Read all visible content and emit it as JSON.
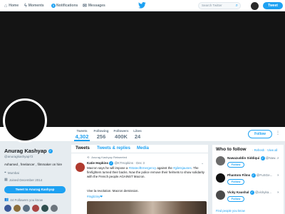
{
  "nav": {
    "home": "Home",
    "moments": "Moments",
    "notifications": "Notifications",
    "notifications_count": "1",
    "messages": "Messages",
    "search_placeholder": "Search Twitter",
    "tweet_button": "Tweet",
    "icons": {
      "home": "home-icon",
      "moments": "bolt-icon",
      "notifications": "bell-icon",
      "messages": "mail-icon",
      "logo": "twitter-bird-icon",
      "search": "search-icon"
    }
  },
  "profile_nav": {
    "stats": [
      {
        "label": "Tweets",
        "value": "4,302",
        "active": true
      },
      {
        "label": "Following",
        "value": "256",
        "active": false
      },
      {
        "label": "Followers",
        "value": "400K",
        "active": false
      },
      {
        "label": "Likes",
        "value": "24",
        "active": false
      }
    ],
    "follow_button": "Follow"
  },
  "profile": {
    "name": "Anurag Kashyap",
    "handle": "@anuragkashyap72",
    "bio": "Ashamed , freelancer , filmmaker on hire",
    "location": "Mumbai",
    "joined": "Joined December 2014",
    "tweet_to_button": "Tweet to Anurag Kashyap",
    "followers_you_know": "44 Followers you know",
    "mini_avatar_colors": [
      "#3b5998",
      "#8a6d3b",
      "#5b7083",
      "#a94442",
      "#2f4f4f",
      "#6c757d"
    ]
  },
  "timeline": {
    "tabs": [
      "Tweets",
      "Tweets & replies",
      "Media"
    ],
    "retweeted_by": "Anurag Kashyap Retweeted",
    "tweet": {
      "author": "Katie Hopkins",
      "handle": "@KTHopkins · Dec 3",
      "text_pre": "Macron says he will impose a ",
      "hashtag1": "#StateofEmergency",
      "text_mid": " against the ",
      "hashtag2": "#giletsjaunes",
      "text_post": ". The firefighters turned their backs. Now the police remove their helmets to show solidarity with the French people AGAINST Macron.",
      "text2": "Vive la revolution. Macron demission.",
      "text3": "#Ingliziny❤"
    }
  },
  "who_to_follow": {
    "title": "Who to follow",
    "refresh": "Refresh",
    "view_all": "View all",
    "suggestions": [
      {
        "name": "Nawazuddin Siddiqui",
        "handle": "@Naw...",
        "button": "Follow",
        "avatar_color": "#6b6b6b"
      },
      {
        "name": "Phantom Films",
        "handle": "@FuSGe...",
        "button": "Follow",
        "avatar_color": "#111111"
      },
      {
        "name": "Vicky Kaushal",
        "handle": "@vickyka...",
        "button": "Follow",
        "avatar_color": "#4a4a4a"
      }
    ],
    "find_people": "Find people you know"
  }
}
